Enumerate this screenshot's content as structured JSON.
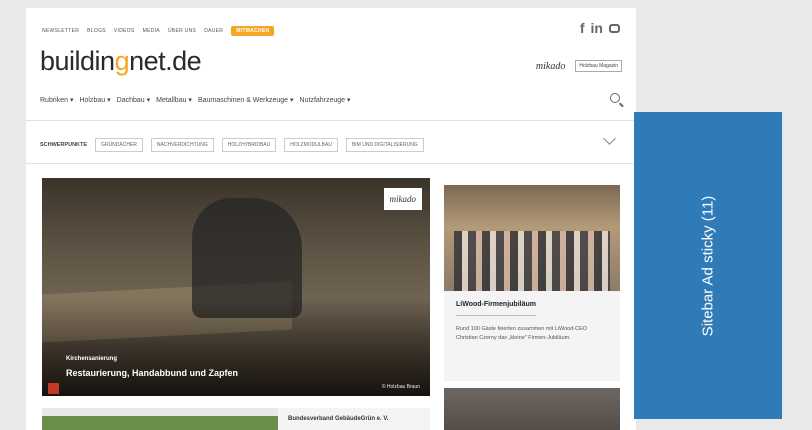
{
  "topnav": {
    "items": [
      "Newsletter",
      "Blogs",
      "Videos",
      "Media",
      "Über uns",
      "Dauer",
      "Mitmachen"
    ]
  },
  "social": {
    "facebook": "f",
    "linkedin": "in"
  },
  "logo": {
    "part1": "buildin",
    "dot": "g",
    "part2": "net.de"
  },
  "partners": {
    "mikado": "mikado",
    "magazine": "Holzbau Magazin"
  },
  "mainnav": {
    "items": [
      "Rubriken ▾",
      "Holzbau ▾",
      "Dachbau ▾",
      "Metallbau ▾",
      "Baumaschinen & Werkzeuge ▾",
      "Nutzfahrzeuge ▾"
    ]
  },
  "focus": {
    "label": "SCHWERPUNKTE",
    "chips": [
      "Gründächer",
      "Nachverdichtung",
      "Holzhybridbau",
      "Holzmodulbau",
      "BIM und Digitalisierung"
    ]
  },
  "hero": {
    "badge": "mikado",
    "kicker": "Kirchensanierung",
    "title": "Restaurierung, Handabbund und Zapfen",
    "credit": "© Holzbau Braun"
  },
  "card": {
    "title": "LiWood-Firmenjubiläum",
    "text": "Rund 100 Gäste feierten zusammen mit LiWood-CEO Christian Czerny das „kleine\" Firmen-Jubiläum."
  },
  "row2": {
    "title": "Bundesverband GebäudeGrün e. V."
  },
  "ad": {
    "label": "Sitebar Ad sticky (11)",
    "color": "#2f7bb7"
  }
}
